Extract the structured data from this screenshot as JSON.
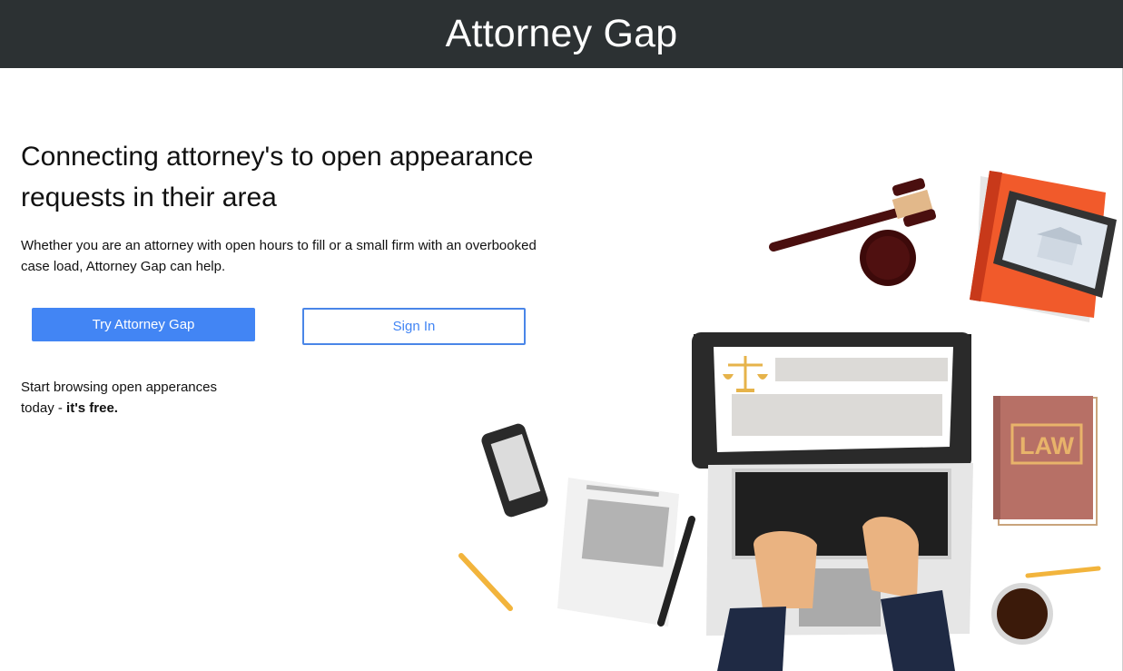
{
  "header": {
    "title": "Attorney Gap"
  },
  "hero": {
    "headline": "Connecting attorney's to open appearance requests in their area",
    "subtext": "Whether you are an attorney with open hours to fill or a small firm with an overbooked case load, Attorney Gap can help."
  },
  "actions": {
    "try_label": "Try Attorney Gap",
    "signin_label": "Sign In"
  },
  "browse": {
    "text": "Start browsing open apperances today - ",
    "emphasis": "it's free."
  },
  "illustration": {
    "book_label": "LAW",
    "icons": [
      "gavel-icon",
      "orange-book-icon",
      "tablet-icon",
      "laptop-icon",
      "scales-icon",
      "phone-icon",
      "document-icon",
      "pen-icon",
      "pencil-icon",
      "law-book-icon",
      "coffee-cup-icon",
      "hands-icon"
    ]
  },
  "colors": {
    "header_bg": "#2c3133",
    "primary_button": "#4285f4",
    "secondary_border": "#4a86e8"
  }
}
